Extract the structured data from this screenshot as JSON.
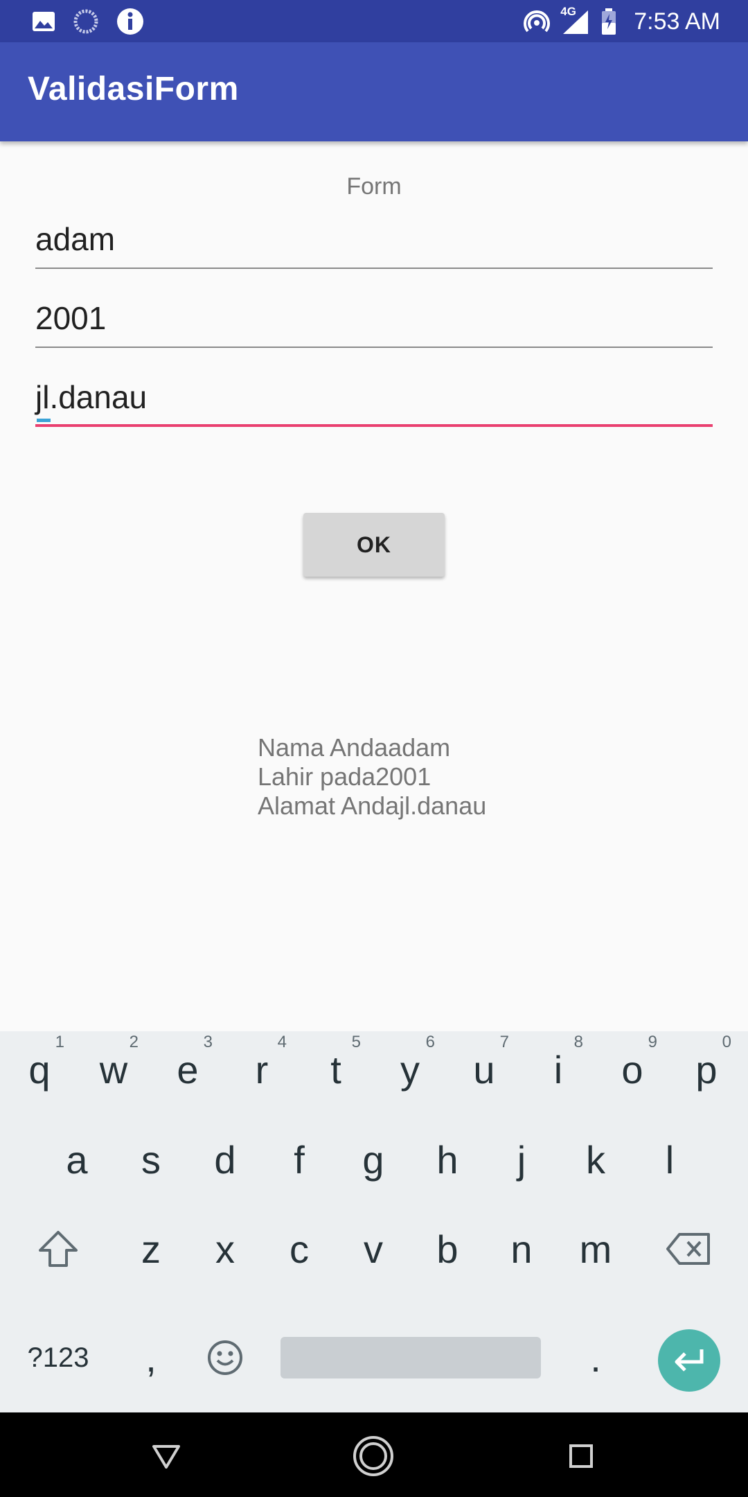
{
  "status_bar": {
    "time": "7:53 AM",
    "network": "4G",
    "icons": [
      "image-icon",
      "loading-icon",
      "info-icon",
      "hotspot-icon",
      "signal-icon",
      "battery-icon"
    ]
  },
  "app_bar": {
    "title": "ValidasiForm"
  },
  "form": {
    "label": "Form",
    "name_value": "adam",
    "year_value": "2001",
    "address_value": "jl.danau",
    "ok_label": "OK"
  },
  "result": {
    "line1": "Nama Andaadam",
    "line2": "Lahir pada2001",
    "line3": "Alamat Andajl.danau"
  },
  "keyboard": {
    "row1": [
      {
        "k": "q",
        "h": "1"
      },
      {
        "k": "w",
        "h": "2"
      },
      {
        "k": "e",
        "h": "3"
      },
      {
        "k": "r",
        "h": "4"
      },
      {
        "k": "t",
        "h": "5"
      },
      {
        "k": "y",
        "h": "6"
      },
      {
        "k": "u",
        "h": "7"
      },
      {
        "k": "i",
        "h": "8"
      },
      {
        "k": "o",
        "h": "9"
      },
      {
        "k": "p",
        "h": "0"
      }
    ],
    "row2": [
      "a",
      "s",
      "d",
      "f",
      "g",
      "h",
      "j",
      "k",
      "l"
    ],
    "row3": [
      "z",
      "x",
      "c",
      "v",
      "b",
      "n",
      "m"
    ],
    "symbols_label": "?123",
    "comma": ",",
    "period": ".",
    "accent_color": "#4db6ac"
  },
  "colors": {
    "status_bar": "#303f9f",
    "app_bar": "#3f51b5",
    "active_underline": "#e94070"
  }
}
